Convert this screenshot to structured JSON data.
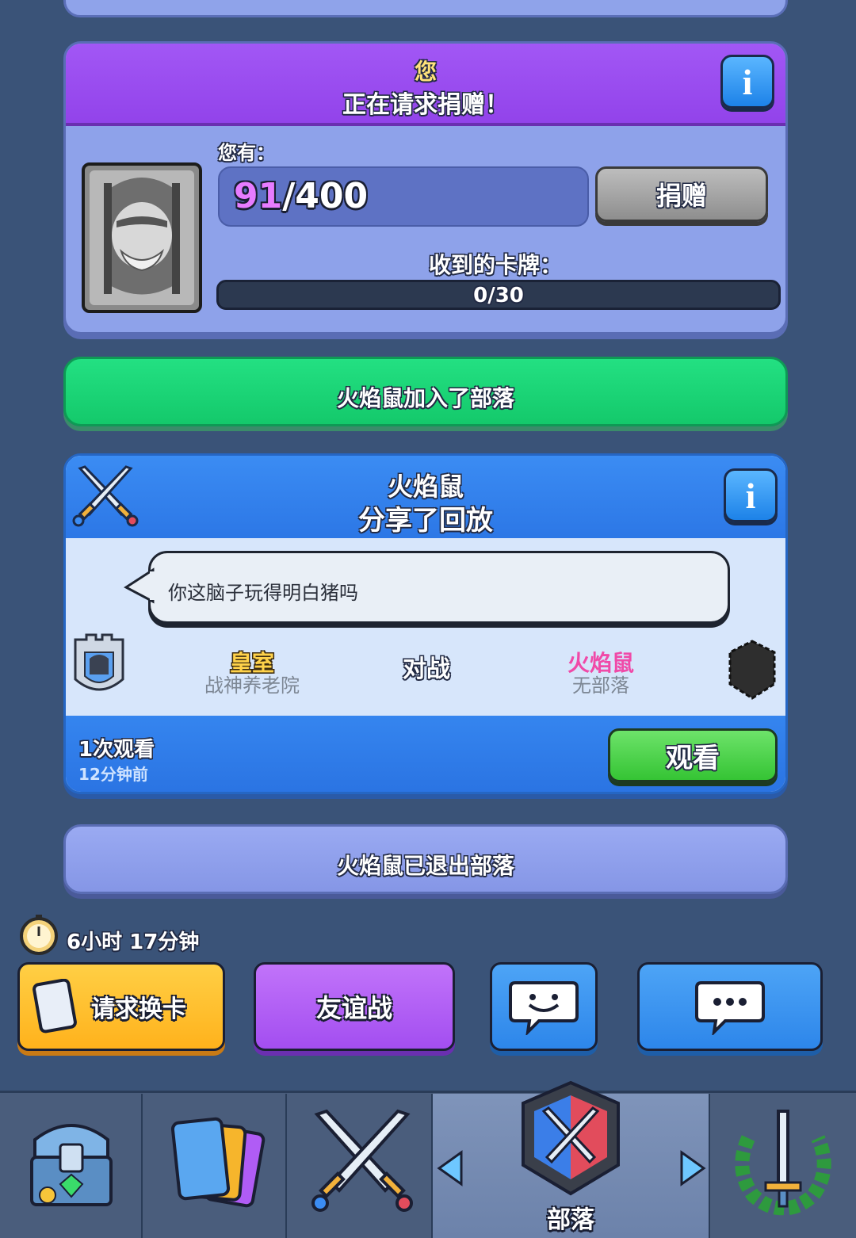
{
  "donation": {
    "header_name": "您",
    "header_text": "正在请求捐赠！",
    "you_have_label": "您有：",
    "have_count": "91",
    "have_total": "/400",
    "donate_button": "捐赠",
    "received_label": "收到的卡牌：",
    "received_value": "0/30",
    "received_progress": 0
  },
  "event_joined": "火焰鼠加入了部落",
  "replay": {
    "player_name": "火焰鼠",
    "action": "分享了回放",
    "comment": "你这脑子玩得明白猪吗",
    "left_player": "皇室",
    "left_clan": "战神养老院",
    "vs_label": "对战",
    "right_player": "火焰鼠",
    "right_clan": "无部落",
    "views": "1次观看",
    "time_ago": "12分钟前",
    "watch_button": "观看"
  },
  "event_left": "火焰鼠已退出部落",
  "timer": "6小时 17分钟",
  "actions": {
    "request_card": "请求换卡",
    "friendly_battle": "友谊战"
  },
  "nav": {
    "active_label": "部落"
  },
  "colors": {
    "background": "#3a5378",
    "purple_header": "#9a4cf0",
    "blue_header": "#2f7de8",
    "green_banner": "#1ed679",
    "lavender_card": "#8aa0e8",
    "orange_button": "#ffbe2e",
    "purple_button": "#b05cf5",
    "blue_button": "#3a95f0",
    "watch_green": "#45d145"
  }
}
